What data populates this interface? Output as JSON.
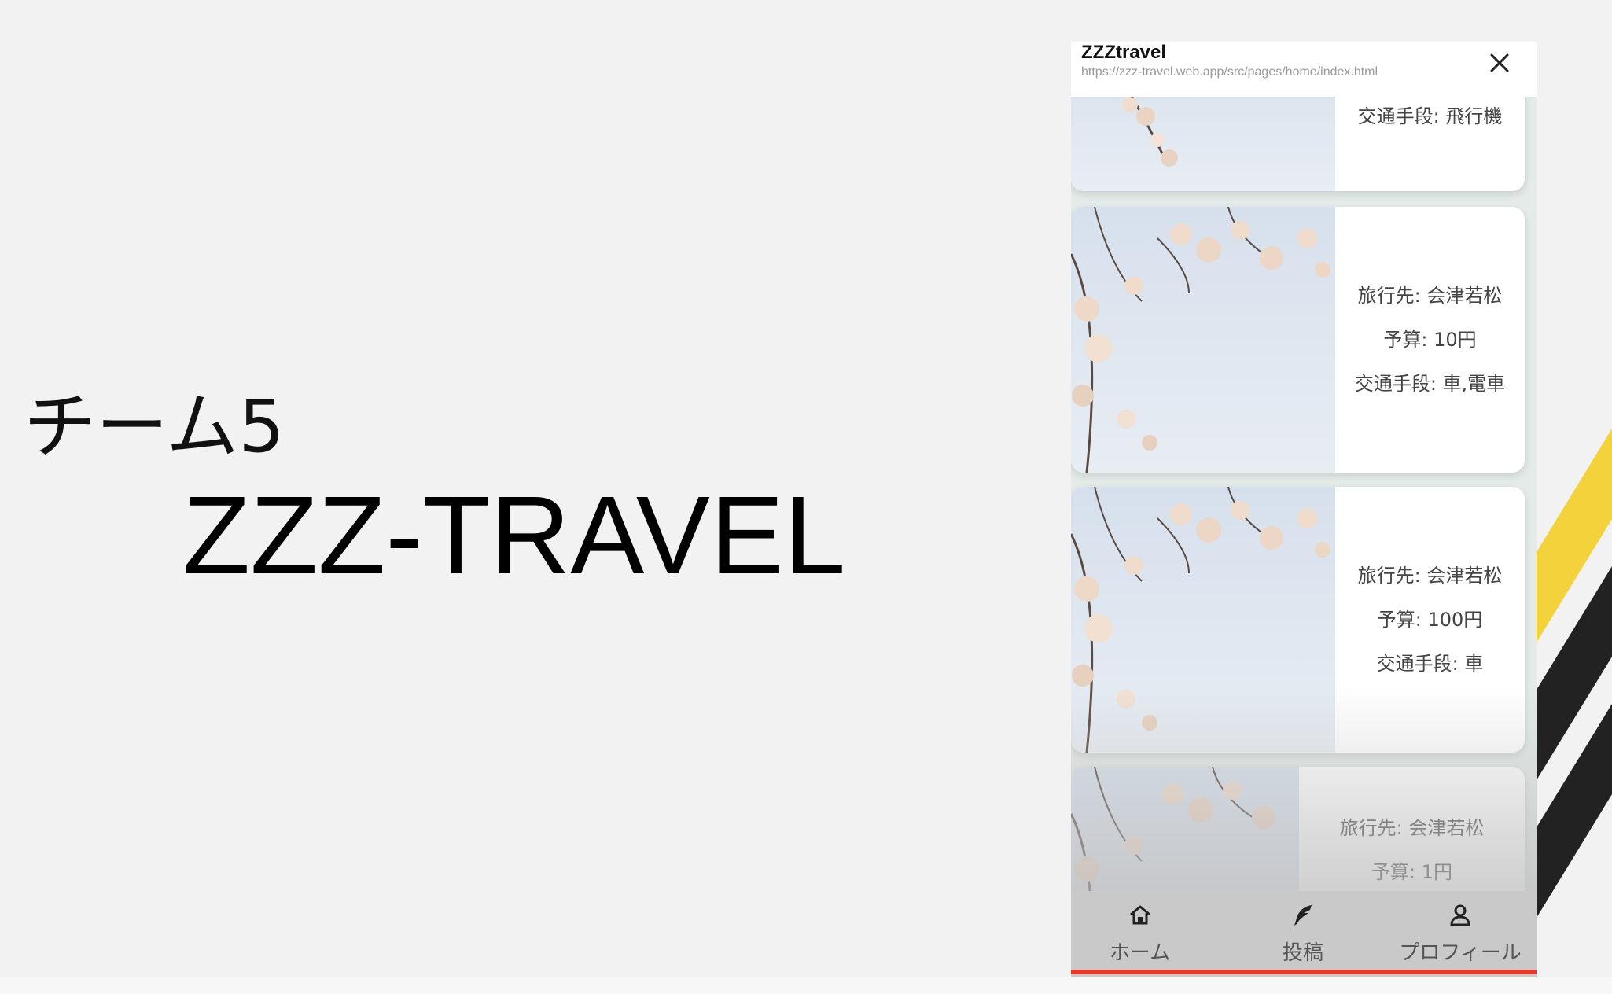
{
  "slide": {
    "team_label": "チーム5",
    "app_title": "ZZZ-TRAVEL"
  },
  "browser": {
    "title": "ZZZtravel",
    "url": "https://zzz-travel.web.app/src/pages/home/index.html",
    "close_icon": "close-icon"
  },
  "posts": [
    {
      "lines": [
        "交通手段: 飛行機"
      ]
    },
    {
      "lines": [
        "旅行先: 会津若松",
        "予算: 10円",
        "交通手段: 車,電車"
      ]
    },
    {
      "lines": [
        "旅行先: 会津若松",
        "予算: 100円",
        "交通手段: 車"
      ]
    },
    {
      "lines": [
        "旅行先: 会津若松",
        "予算: 1円"
      ]
    }
  ],
  "nav": {
    "items": [
      {
        "label": "ホーム",
        "icon": "home-icon"
      },
      {
        "label": "投稿",
        "icon": "quill-icon"
      },
      {
        "label": "プロフィール",
        "icon": "person-icon"
      }
    ]
  },
  "colors": {
    "accent": "#e23b2e",
    "stripe_yellow": "#f4d23c",
    "stripe_black": "#222222"
  }
}
